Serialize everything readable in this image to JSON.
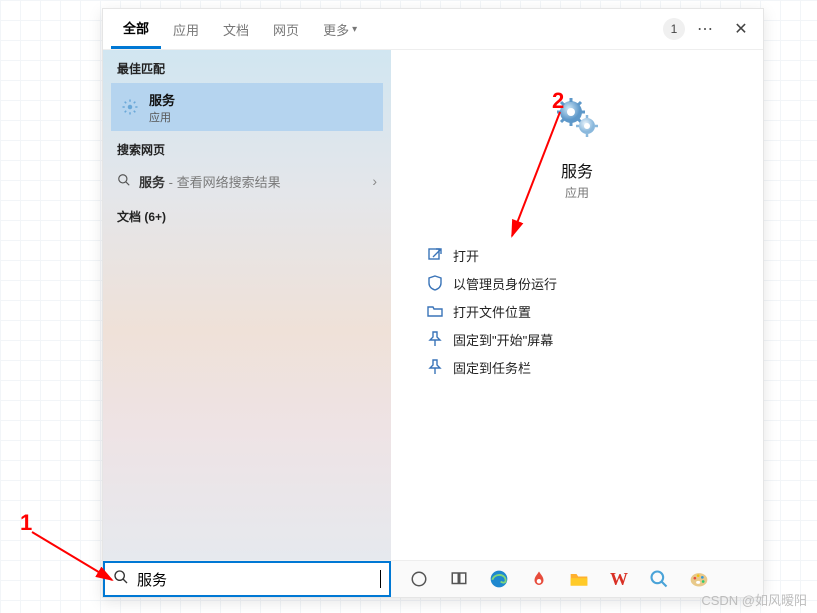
{
  "tabs": {
    "all": "全部",
    "apps": "应用",
    "docs": "文档",
    "web": "网页",
    "more": "更多"
  },
  "badge_count": "1",
  "left": {
    "best_match_label": "最佳匹配",
    "best_match_title": "服务",
    "best_match_sub": "应用",
    "web_label": "搜索网页",
    "web_term": "服务",
    "web_desc": " - 查看网络搜索结果",
    "docs_label": "文档 (6+)"
  },
  "right": {
    "title": "服务",
    "sub": "应用",
    "actions": {
      "open": "打开",
      "run_admin": "以管理员身份运行",
      "open_loc": "打开文件位置",
      "pin_start": "固定到\"开始\"屏幕",
      "pin_taskbar": "固定到任务栏"
    }
  },
  "search": {
    "value": "服务"
  },
  "annotation": {
    "one": "1",
    "two": "2"
  },
  "tray": {
    "wps": "W"
  },
  "watermark": "CSDN @如风暧阳"
}
